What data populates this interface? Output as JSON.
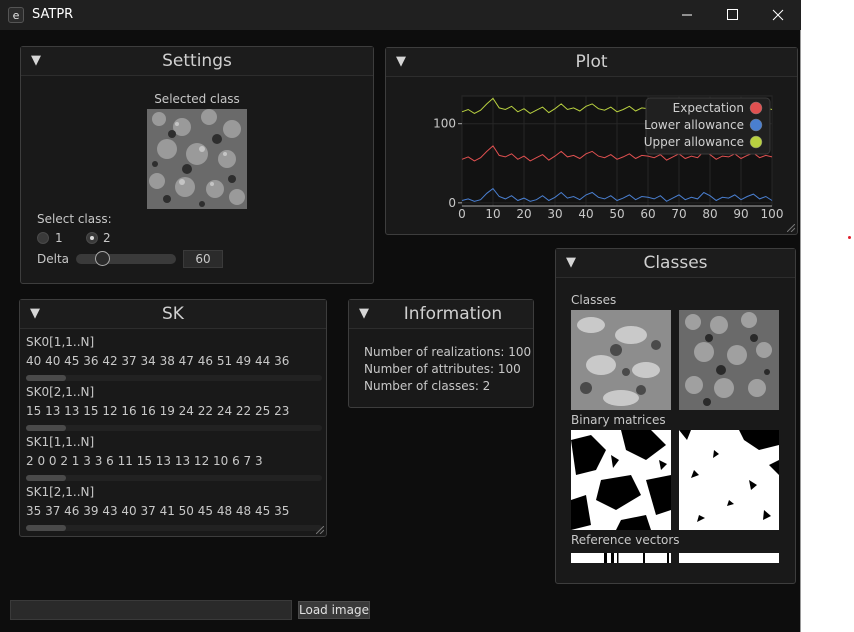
{
  "window": {
    "title": "SATPR",
    "app_icon_glyph": "e",
    "icons": [
      "minimize-icon",
      "maximize-icon",
      "close-icon"
    ]
  },
  "settings": {
    "title": "Settings",
    "selected_class_label": "Selected class",
    "select_class_label": "Select class:",
    "options": [
      "1",
      "2"
    ],
    "selected_option": "2",
    "delta_label": "Delta",
    "delta_value": "60",
    "delta_fraction": 0.3
  },
  "plot": {
    "title": "Plot",
    "legend": [
      "Expectation",
      "Lower allowance",
      "Upper allowance"
    ],
    "colors": {
      "expectation": "#e05050",
      "lower": "#4a7fd0",
      "upper": "#b8d040"
    }
  },
  "chart_data": {
    "type": "line",
    "x": [
      0,
      2,
      4,
      6,
      8,
      10,
      12,
      14,
      16,
      18,
      20,
      22,
      24,
      26,
      28,
      30,
      32,
      34,
      36,
      38,
      40,
      42,
      44,
      46,
      48,
      50,
      52,
      54,
      56,
      58,
      60,
      62,
      64,
      66,
      68,
      70,
      72,
      74,
      76,
      78,
      80,
      82,
      84,
      86,
      88,
      90,
      92,
      94,
      96,
      98,
      100
    ],
    "xticks": [
      "0",
      "10",
      "20",
      "30",
      "40",
      "50",
      "60",
      "70",
      "80",
      "90",
      "100"
    ],
    "yticks": [
      "0",
      "100"
    ],
    "xlim": [
      0,
      100
    ],
    "ylim": [
      -4,
      135
    ],
    "series": [
      {
        "name": "Upper allowance",
        "values": [
          115,
          118,
          113,
          117,
          125,
          132,
          120,
          118,
          122,
          115,
          119,
          113,
          117,
          121,
          114,
          119,
          125,
          118,
          120,
          116,
          122,
          125,
          119,
          117,
          121,
          115,
          118,
          122,
          116,
          120,
          119,
          117,
          121,
          114,
          118,
          122,
          116,
          119,
          117,
          125,
          121,
          115,
          119,
          118,
          122,
          116,
          120,
          123,
          117,
          120,
          118
        ]
      },
      {
        "name": "Expectation",
        "values": [
          55,
          58,
          53,
          57,
          65,
          72,
          60,
          58,
          62,
          55,
          59,
          53,
          57,
          61,
          54,
          59,
          65,
          58,
          60,
          56,
          62,
          65,
          59,
          57,
          61,
          55,
          58,
          62,
          56,
          60,
          59,
          57,
          61,
          54,
          58,
          62,
          56,
          59,
          57,
          65,
          61,
          55,
          59,
          58,
          62,
          56,
          60,
          63,
          57,
          60,
          58
        ]
      },
      {
        "name": "Lower allowance",
        "values": [
          3,
          5,
          2,
          4,
          12,
          18,
          8,
          5,
          9,
          3,
          6,
          2,
          4,
          9,
          3,
          7,
          13,
          6,
          8,
          4,
          10,
          13,
          7,
          5,
          9,
          3,
          6,
          10,
          4,
          8,
          7,
          5,
          9,
          2,
          6,
          10,
          4,
          7,
          5,
          13,
          9,
          3,
          7,
          6,
          10,
          4,
          8,
          11,
          5,
          8,
          3
        ]
      }
    ]
  },
  "classes": {
    "title": "Classes",
    "classes_label": "Classes",
    "binary_label": "Binary matrices",
    "reference_label": "Reference vectors"
  },
  "sk": {
    "title": "SK",
    "rows": [
      {
        "label": "SK0[1,1..N]",
        "values": "40  40  45  36  42  37  34  38  47  46  51  49  44  36"
      },
      {
        "label": "SK0[2,1..N]",
        "values": "15  13  13  15  12  16  16  19  24  22  24  22  25  23"
      },
      {
        "label": "SK1[1,1..N]",
        "values": "2  0  0  2  1  3  3  6  11  15  13  13  12  10  6  7  3"
      },
      {
        "label": "SK1[2,1..N]",
        "values": "35  37  46  39  43  40  37  41  50  45  48  48  45  35"
      }
    ]
  },
  "information": {
    "title": "Information",
    "lines": [
      "Number of realizations: 100",
      "Number of attributes: 100",
      "Number of classes: 2"
    ]
  },
  "bottom": {
    "load_button": "Load image",
    "path_value": ""
  }
}
